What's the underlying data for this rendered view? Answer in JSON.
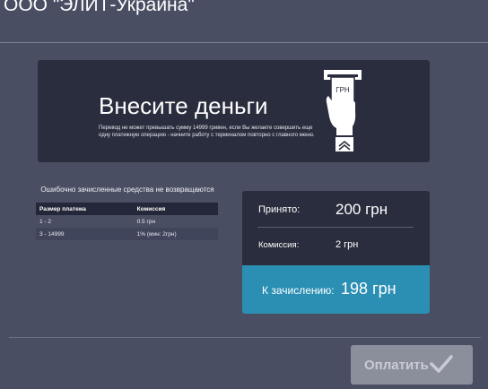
{
  "header": {
    "title": "ООО \"ЭЛИТ-Украина\""
  },
  "banner": {
    "heading": "Внесите деньги",
    "text": "Перевод не может превышать сумму 14999 гривен, если Вы желаете совершить еще одну платежную операцию - начните работу с терминалом повторно с главного меню.",
    "icon_label": "ГРН",
    "icon": "cash-insert-icon"
  },
  "fees": {
    "warning": "Ошибочно зачисленные средства не возвращаются",
    "headers": [
      "Размер платежа",
      "Комиссия"
    ],
    "rows": [
      [
        "1 - 2",
        "0.5 грн"
      ],
      [
        "3 - 14999",
        "1% (мин: 2грн)"
      ]
    ]
  },
  "summary": {
    "accepted_label": "Принято:",
    "accepted_value": "200 грн",
    "commission_label": "Комиссия:",
    "commission_value": "2 грн",
    "credit_label": "К зачислению:",
    "credit_value": "198 грн"
  },
  "actions": {
    "pay_label": "Оплатить",
    "pay_icon": "checkmark-icon"
  },
  "colors": {
    "background": "#4a4e63",
    "panel": "#2a2d3d",
    "accent": "#2b8fb3",
    "button_disabled": "#8b8f9b"
  }
}
